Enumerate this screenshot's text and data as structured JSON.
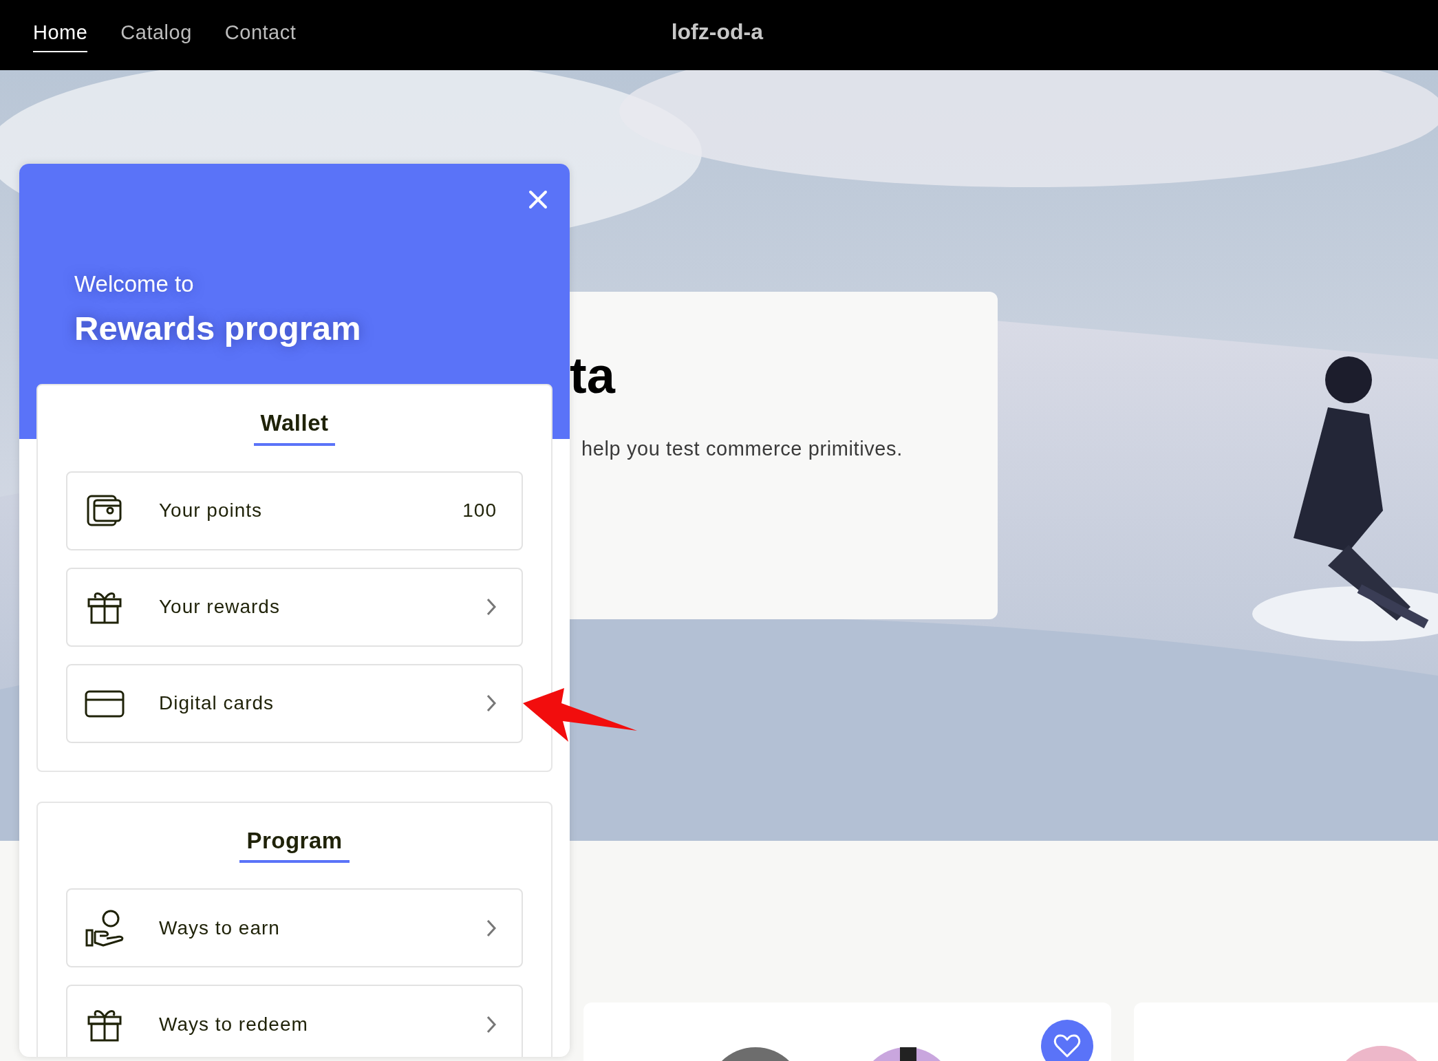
{
  "nav": {
    "links": [
      {
        "label": "Home",
        "selected": true
      },
      {
        "label": "Catalog",
        "selected": false
      },
      {
        "label": "Contact",
        "selected": false
      }
    ],
    "brand": "lofz-od-a"
  },
  "hero": {
    "image": {
      "kind": "picture"
    },
    "title": "ta",
    "text": "help you test commerce primitives."
  },
  "products": [
    {
      "kind": "picture",
      "heart_button": true
    },
    {
      "kind": "picture"
    }
  ],
  "rewards_panel": {
    "greeting": "Welcome to",
    "title": "Rewards program",
    "sections": [
      {
        "title": "Wallet",
        "rows": [
          {
            "kind": "wallet",
            "label": "Your points",
            "value": "100"
          },
          {
            "kind": "gift",
            "label": "Your rewards"
          },
          {
            "kind": "card",
            "label": "Digital cards"
          }
        ]
      },
      {
        "title": "Program",
        "rows": [
          {
            "kind": "hand-coin",
            "label": "Ways to earn"
          },
          {
            "kind": "gift",
            "label": "Ways to redeem"
          }
        ]
      }
    ]
  },
  "annotations": [
    {
      "kind": "arrow"
    }
  ]
}
